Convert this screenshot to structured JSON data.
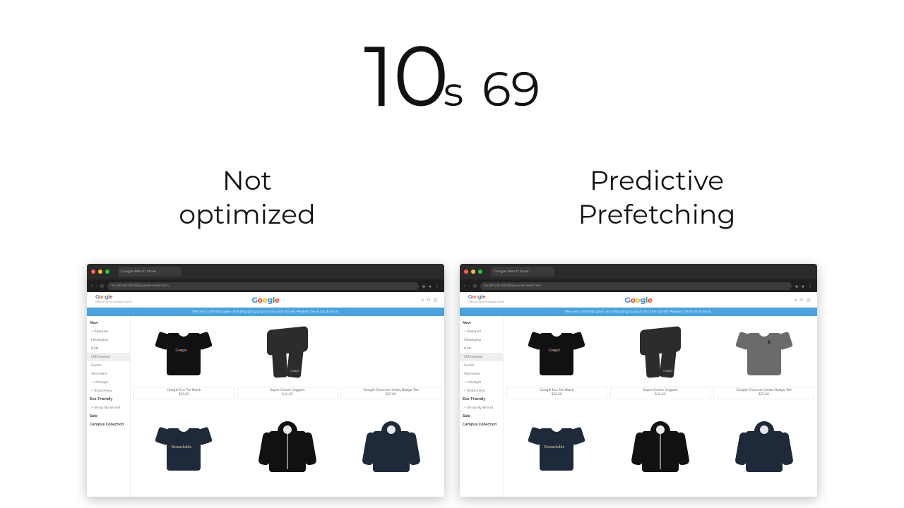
{
  "timer": {
    "seconds": "10",
    "unit": "s",
    "fraction": "69"
  },
  "labels": {
    "left": "Not\noptimized",
    "right": "Predictive\nPrefetching"
  },
  "browser": {
    "tab_title": "Google Merch Store",
    "url": "localhost:3000/apparel-selection"
  },
  "store": {
    "brand_tagline": "official merchandise store",
    "banner": "We are currently open and shipping to your favorite stores! Please check back soon.",
    "sidebar": {
      "heading": "New",
      "items": [
        "Apparel",
        "Headgear",
        "Kids",
        "Officewear",
        "Socks",
        "Womens"
      ],
      "selected_index": 3,
      "subheading_items": [
        "Lifestyle",
        "Stationery"
      ],
      "bottom_items": [
        "Eco-Friendly",
        "Shop By Brand",
        "Sale",
        "Campus Collection"
      ]
    },
    "products_row1": [
      {
        "name": "Google Eco Tee Black",
        "price": "$30.00"
      },
      {
        "name": "Super Cotton Joggers",
        "price": "$45.00"
      },
      {
        "name": "Google Charcoal Unisex Badge Tee",
        "price": "$27.00"
      }
    ]
  },
  "panels": {
    "left_third_loaded": false,
    "right_third_loaded": true
  }
}
